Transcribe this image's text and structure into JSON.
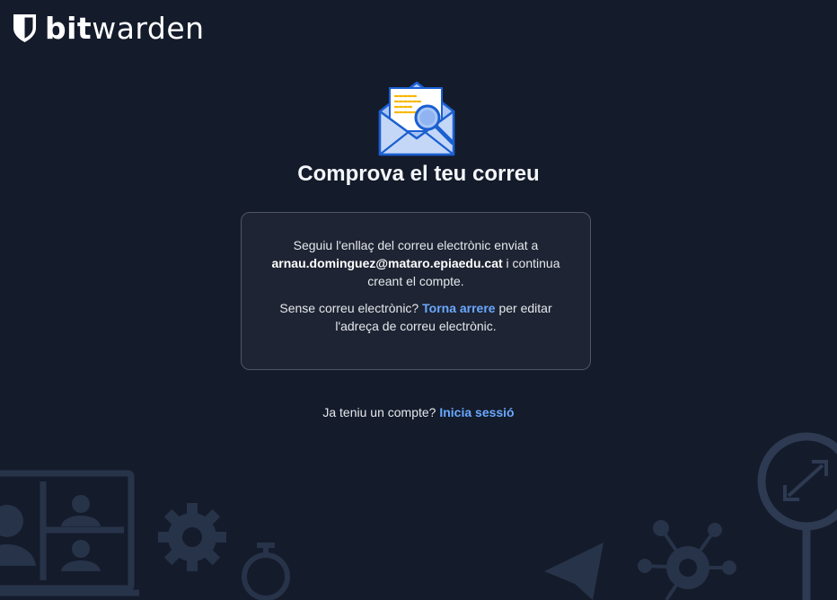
{
  "brand": {
    "name_bold": "bit",
    "name_light": "warden"
  },
  "heading": {
    "title": "Comprova el teu correu"
  },
  "card": {
    "line1_prefix": "Seguiu l'enllaç del correu electrònic enviat a",
    "email": "arnau.dominguez@mataro.epiaedu.cat",
    "line1_suffix": "i continua creant el compte.",
    "line2_prefix": "Sense correu electrònic?",
    "back_link": "Torna arrere",
    "line2_suffix": "per editar l'adreça de correu electrònic."
  },
  "footer": {
    "prompt": "Ja teniu un compte?",
    "login_link": "Inicia sessió"
  },
  "colors": {
    "background": "#141b2b",
    "card_bg": "#1e2433",
    "card_border": "#4d5566",
    "link": "#6aa8ff",
    "illustration": "#2a3650"
  },
  "icons": {
    "logo": "bitwarden-shield-icon",
    "hero": "envelope-magnifier-icon"
  }
}
